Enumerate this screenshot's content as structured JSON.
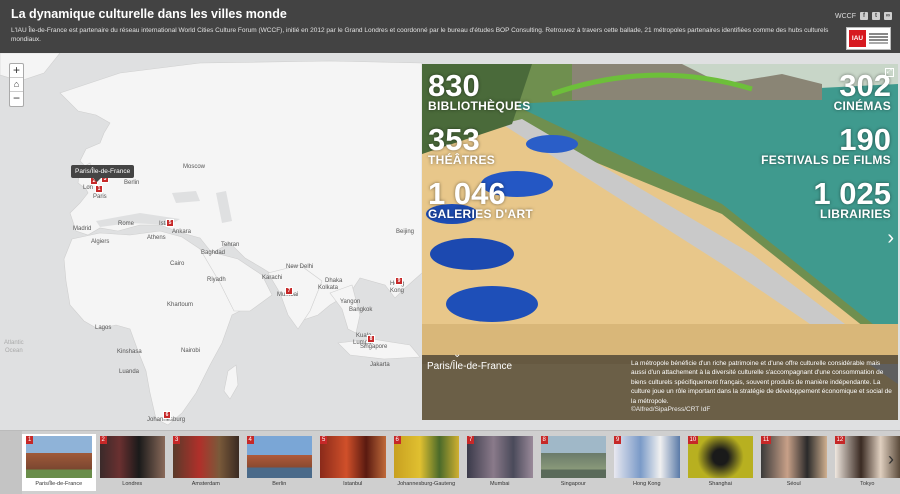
{
  "header": {
    "title": "La dynamique culturelle dans les villes monde",
    "subtitle": "L'IAU Île-de-France est partenaire du réseau international World Cities Culture Forum (WCCF), initié en 2012 par le Grand Londres et coordonné par le bureau d'études BOP Consulting. Retrouvez à travers cette ballade, 21 métropoles partenaires identifiées comme des hubs culturels mondiaux.",
    "share_label": "WCCF",
    "share_icons": [
      "facebook-icon",
      "twitter-icon",
      "link-icon"
    ],
    "logo_text": "IAU"
  },
  "map": {
    "tooltip": "Paris/Île-de-France",
    "zoom_in": "+",
    "zoom_out": "−",
    "home": "⌂",
    "labels": [
      {
        "id": "moscow",
        "text": "Moscow"
      },
      {
        "id": "london",
        "text": "Lon"
      },
      {
        "id": "berlin",
        "text": "Berlin"
      },
      {
        "id": "paris",
        "text": "Paris"
      },
      {
        "id": "madrid",
        "text": "Madrid"
      },
      {
        "id": "rome",
        "text": "Rome"
      },
      {
        "id": "algiers",
        "text": "Algiers"
      },
      {
        "id": "athens",
        "text": "Athens"
      },
      {
        "id": "ankara",
        "text": "Ankara"
      },
      {
        "id": "istanbul",
        "text": "Istan"
      },
      {
        "id": "tehran",
        "text": "Tehran"
      },
      {
        "id": "baghdad",
        "text": "Baghdad"
      },
      {
        "id": "cairo",
        "text": "Cairo"
      },
      {
        "id": "riyadh",
        "text": "Riyadh"
      },
      {
        "id": "karachi",
        "text": "Karachi"
      },
      {
        "id": "newdelhi",
        "text": "New Delhi"
      },
      {
        "id": "mumbai",
        "text": "Mumbai"
      },
      {
        "id": "dhaka",
        "text": "Dhaka"
      },
      {
        "id": "kolkata",
        "text": "Kolkata"
      },
      {
        "id": "yangon",
        "text": "Yangon"
      },
      {
        "id": "bangkok",
        "text": "Bangkok"
      },
      {
        "id": "khartoum",
        "text": "Khartoum"
      },
      {
        "id": "lagos",
        "text": "Lagos"
      },
      {
        "id": "kinshasa",
        "text": "Kinshasa"
      },
      {
        "id": "nairobi",
        "text": "Nairobi"
      },
      {
        "id": "luanda",
        "text": "Luanda"
      },
      {
        "id": "johannesburg",
        "text": "Johannesburg"
      },
      {
        "id": "beijing",
        "text": "Beijing"
      },
      {
        "id": "hongkong",
        "text": "Hong"
      },
      {
        "id": "hongkong2",
        "text": "Kong"
      },
      {
        "id": "singapore",
        "text": "Singapore"
      },
      {
        "id": "jakarta",
        "text": "Jakarta"
      },
      {
        "id": "kualalumpur",
        "text": "Kuala"
      },
      {
        "id": "lumpur",
        "text": "Lumpur"
      }
    ],
    "ocean": [
      "Atlantic",
      "Ocean"
    ],
    "markers": [
      "1",
      "2",
      "3",
      "5",
      "7",
      "8",
      "9",
      "6"
    ]
  },
  "slide": {
    "stats": [
      {
        "num": "830",
        "label": "BIBLIOTHÈQUES"
      },
      {
        "num": "302",
        "label": "CINÉMAS"
      },
      {
        "num": "353",
        "label": "THÉÂTRES"
      },
      {
        "num": "190",
        "label": "FESTIVALS DE FILMS"
      },
      {
        "num": "1 046",
        "label": "GALERIES D'ART"
      },
      {
        "num": "1 025",
        "label": "LIBRAIRIES"
      }
    ],
    "caption_title": "Paris/Île-de-France",
    "caption_text": "La métropole bénéficie d'un riche patrimoine et d'une offre culturelle considérable mais aussi d'un attachement à la diversité culturelle s'accompagnant d'une consommation de biens culturels spécifiquement français, souvent produits de manière indépendante. La culture joue un rôle important dans la stratégie de développement économique et social de la métropole.",
    "credit": "©Alfred/SipaPress/CRT IdF"
  },
  "thumbnails": [
    {
      "idx": "1",
      "name": "Paris/Île-de-France"
    },
    {
      "idx": "2",
      "name": "Londres"
    },
    {
      "idx": "3",
      "name": "Amsterdam"
    },
    {
      "idx": "4",
      "name": "Berlin"
    },
    {
      "idx": "5",
      "name": "Istanbul"
    },
    {
      "idx": "6",
      "name": "Johannesburg-Gauteng"
    },
    {
      "idx": "7",
      "name": "Mumbai"
    },
    {
      "idx": "8",
      "name": "Singapour"
    },
    {
      "idx": "9",
      "name": "Hong Kong"
    },
    {
      "idx": "10",
      "name": "Shanghai"
    },
    {
      "idx": "11",
      "name": "Séoul"
    },
    {
      "idx": "12",
      "name": "Tokyo"
    }
  ],
  "colors": {
    "header_bg": "#434343",
    "marker": "#c62828",
    "accent": "#d71920"
  }
}
